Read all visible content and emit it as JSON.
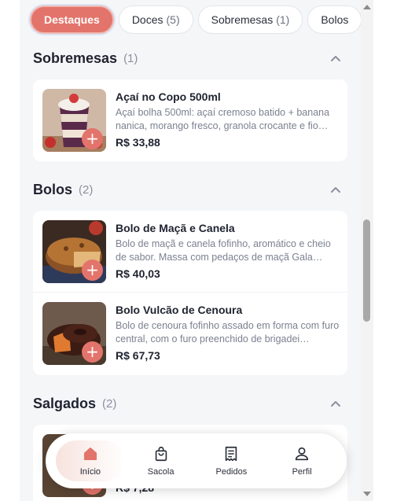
{
  "chips": [
    {
      "label": "Destaques",
      "count": "",
      "active": true
    },
    {
      "label": "Doces",
      "count": "(5)",
      "active": false
    },
    {
      "label": "Sobremesas",
      "count": "(1)",
      "active": false
    },
    {
      "label": "Bolos",
      "count": "",
      "active": false
    }
  ],
  "sections": [
    {
      "title": "Sobremesas",
      "count": "(1)",
      "items": [
        {
          "name": "Açaí no Copo 500ml",
          "description": "Açaí bolha 500ml: açaí cremoso batido + banana nanica, morango fresco, granola crocante e fio…",
          "price": "R$ 33,88",
          "image_icon": "acai-cup-image"
        }
      ]
    },
    {
      "title": "Bolos",
      "count": "(2)",
      "items": [
        {
          "name": "Bolo de Maçã e Canela",
          "description": "Bolo de maçã e canela fofinho, aromático e cheio de sabor. Massa com pedaços de maçã Gala…",
          "price": "R$ 40,03",
          "image_icon": "apple-cake-image"
        },
        {
          "name": "Bolo Vulcão de Cenoura",
          "description": "Bolo de cenoura fofinho assado em forma com furo central, com o furo preenchido de brigadei…",
          "price": "R$ 67,73",
          "image_icon": "carrot-cake-image"
        }
      ]
    },
    {
      "title": "Salgados",
      "count": "(2)",
      "items": [
        {
          "name": "",
          "description": "",
          "price": "R$ 7,28",
          "image_icon": "savory-image"
        }
      ]
    }
  ],
  "add_button_label": "+",
  "nav": [
    {
      "label": "Início",
      "icon": "home-icon",
      "active": true
    },
    {
      "label": "Sacola",
      "icon": "bag-icon",
      "active": false
    },
    {
      "label": "Pedidos",
      "icon": "receipt-icon",
      "active": false
    },
    {
      "label": "Perfil",
      "icon": "user-icon",
      "active": false
    }
  ],
  "colors": {
    "accent": "#e3746b",
    "background": "#f5f6f8",
    "card": "#ffffff",
    "text": "#1f2330",
    "muted": "#7c8190"
  }
}
